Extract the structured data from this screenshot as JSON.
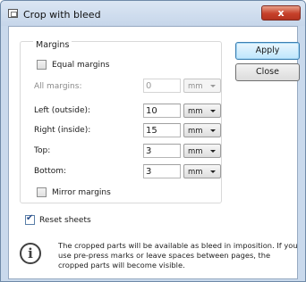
{
  "window": {
    "title": "Crop with bleed",
    "icon": "crop-app-icon",
    "close_glyph": "x"
  },
  "margins_group": {
    "legend": "Margins",
    "equal_margins": {
      "label": "Equal margins",
      "checked": false
    },
    "all_margins": {
      "label": "All margins:",
      "value": "0",
      "unit": "mm",
      "enabled": false
    },
    "fields": [
      {
        "label": "Left (outside):",
        "value": "10",
        "unit": "mm"
      },
      {
        "label": "Right (inside):",
        "value": "15",
        "unit": "mm"
      },
      {
        "label": "Top:",
        "value": "3",
        "unit": "mm"
      },
      {
        "label": "Bottom:",
        "value": "3",
        "unit": "mm"
      }
    ],
    "mirror_margins": {
      "label": "Mirror margins",
      "checked": false
    }
  },
  "reset_sheets": {
    "label": "Reset sheets",
    "checked": true
  },
  "buttons": {
    "apply": "Apply",
    "close": "Close"
  },
  "info": {
    "icon": "info-icon",
    "glyph": "i",
    "text": "The cropped parts will be available as bleed in imposition. If you use pre-press marks or leave spaces between pages, the cropped parts will become visible."
  }
}
